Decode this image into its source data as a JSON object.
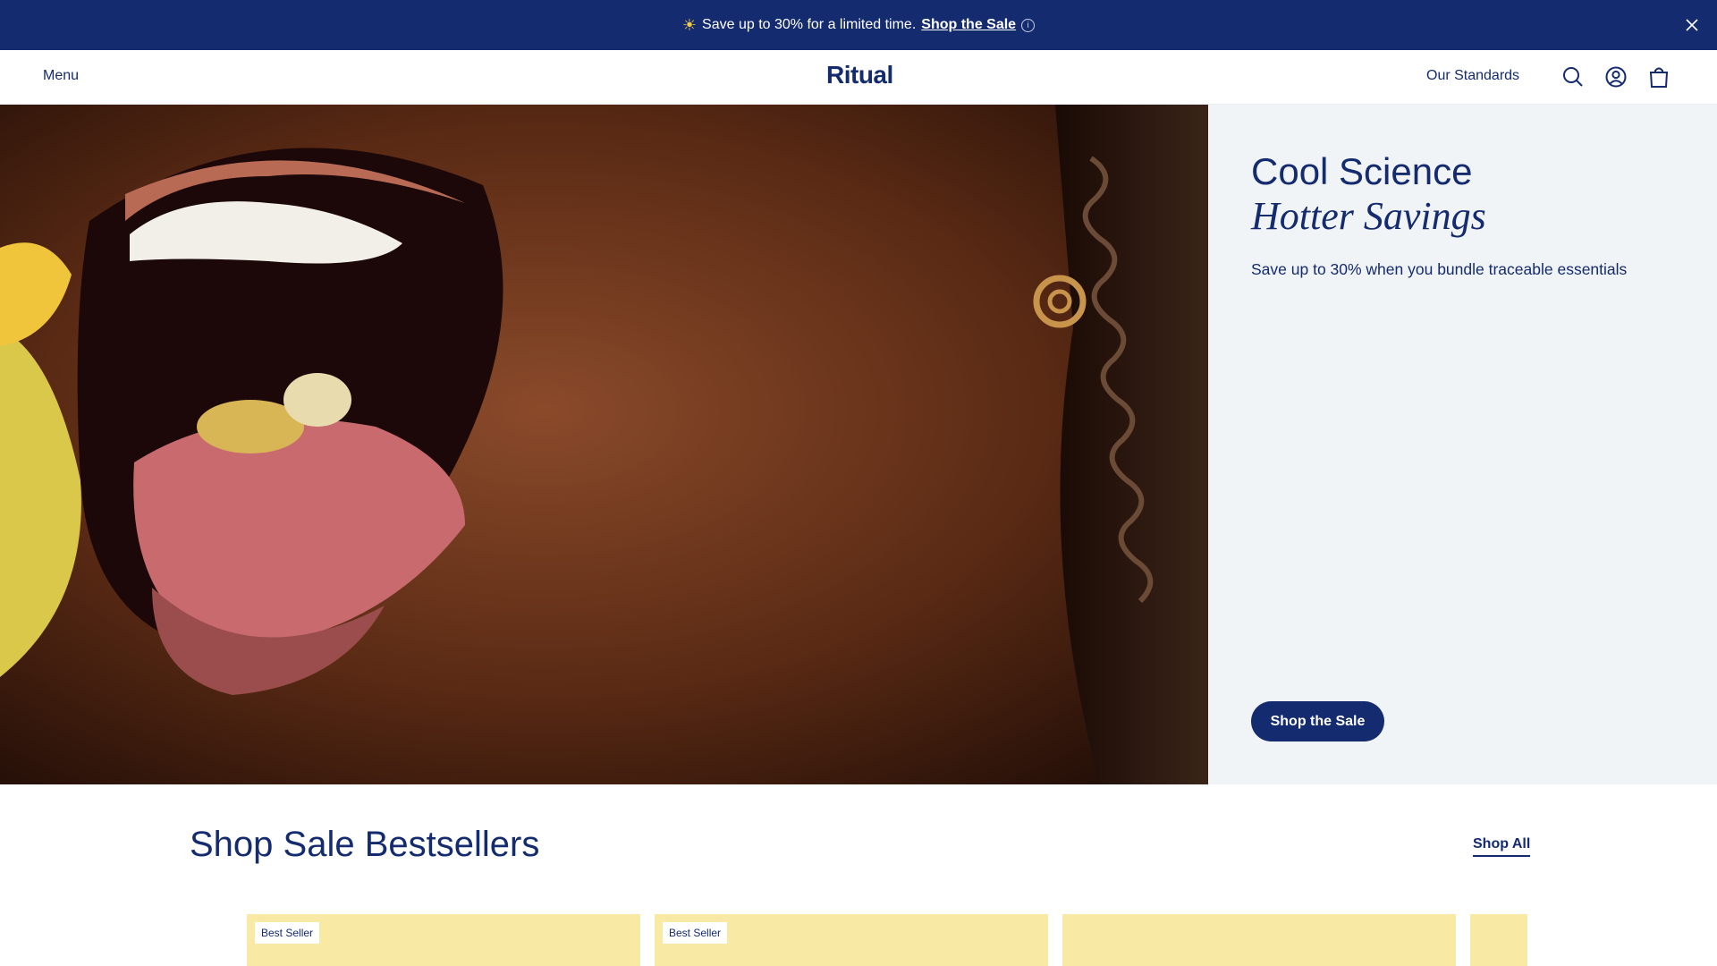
{
  "announcement": {
    "text": "Save up to 30% for a limited time.",
    "link_label": "Shop the Sale",
    "info_glyph": "i"
  },
  "nav": {
    "menu_label": "Menu",
    "logo": "Ritual",
    "standards_label": "Our Standards"
  },
  "hero": {
    "title": "Cool Science",
    "title_italic": "Hotter Savings",
    "subtitle": "Save up to 30% when you bundle traceable essentials",
    "cta_label": "Shop the Sale"
  },
  "bestsellers": {
    "title": "Shop Sale Bestsellers",
    "shop_all_label": "Shop All",
    "cards": [
      {
        "badge": "Best Seller"
      },
      {
        "badge": "Best Seller"
      },
      {
        "badge": ""
      },
      {
        "badge": ""
      }
    ]
  },
  "colors": {
    "brand_navy": "#142b6f",
    "panel_bg": "#f1f4f6",
    "card_bg": "#f8e9a5"
  },
  "icons": [
    "sun-icon",
    "info-icon",
    "close-icon",
    "search-icon",
    "account-icon",
    "bag-icon",
    "pause-icon"
  ]
}
